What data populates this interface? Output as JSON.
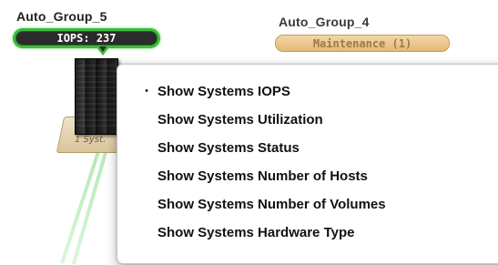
{
  "groups": [
    {
      "title": "Auto_Group_5",
      "badge": "IOPS: 237",
      "system_label": "1 Syst."
    },
    {
      "title": "Auto_Group_4",
      "badge": "Maintenance (1)"
    }
  ],
  "context_menu": {
    "items": [
      {
        "label": "Show Systems IOPS",
        "selected": true,
        "marker": "•"
      },
      {
        "label": "Show Systems Utilization",
        "selected": false,
        "marker": ""
      },
      {
        "label": "Show Systems Status",
        "selected": false,
        "marker": ""
      },
      {
        "label": "Show Systems Number of Hosts",
        "selected": false,
        "marker": ""
      },
      {
        "label": "Show Systems Number of Volumes",
        "selected": false,
        "marker": ""
      },
      {
        "label": "Show Systems Hardware Type",
        "selected": false,
        "marker": ""
      }
    ]
  },
  "colors": {
    "iops_border": "#3dbb3d",
    "iops_fill": "#2b2b2b",
    "maintenance_fill": "#e3b978",
    "menu_background": "#ffffff"
  },
  "icons": {
    "storage_system": "server-rack-icon",
    "selected_marker": "bullet-icon"
  }
}
